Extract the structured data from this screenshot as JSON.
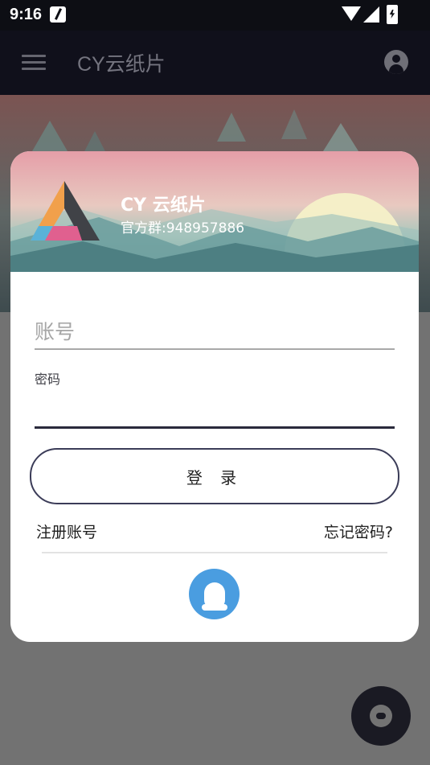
{
  "status_bar": {
    "time": "9:16"
  },
  "app_bar": {
    "title": "CY云纸片"
  },
  "login_card": {
    "brand_name": "CY 云纸片",
    "group_text": "官方群:948957886",
    "account_placeholder": "账号",
    "password_label": "密码",
    "password_value": "",
    "login_button": "登 录",
    "register_link": "注册账号",
    "forgot_link": "忘记密码?"
  },
  "icons": {
    "menu": "menu-icon",
    "account": "account-circle-icon",
    "qq": "qq-icon",
    "cloud": "cloud-icon"
  },
  "colors": {
    "app_bar": "#10101b",
    "button_border": "#3b3c58",
    "qq_blue": "#4a9de0",
    "fab": "#1a1a23"
  }
}
